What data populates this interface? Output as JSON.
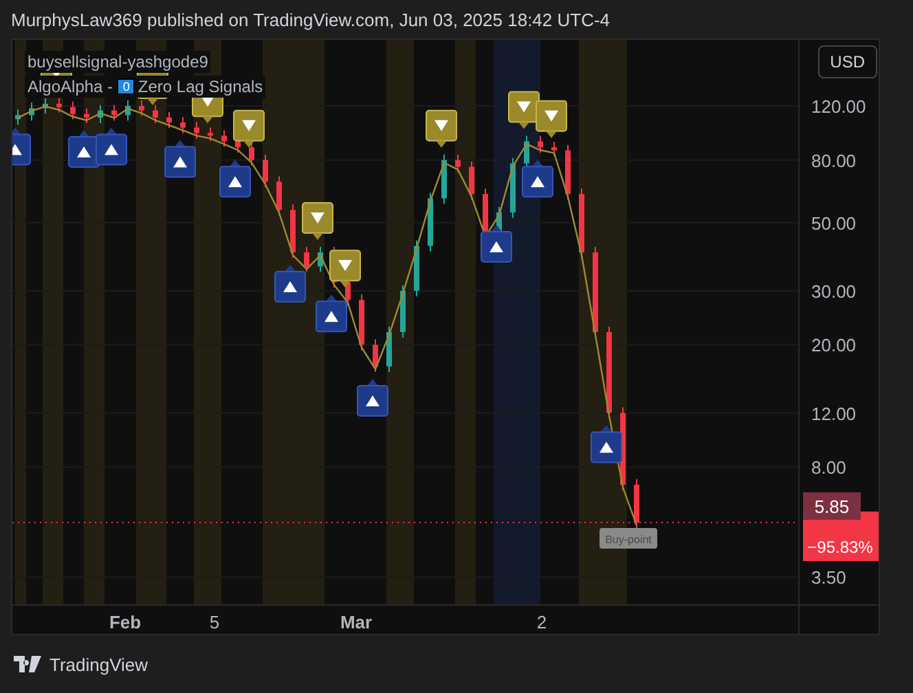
{
  "header": {
    "title": "MurphysLaw369 published on TradingView.com, Jun 03, 2025 18:42 UTC-4"
  },
  "legend": {
    "script": "buysellsignal-yashgode9",
    "indicator_prefix": "AlgoAlpha - ",
    "indicator_badge": "0",
    "indicator_name": "Zero Lag Signals"
  },
  "currency_button": "USD",
  "chart": {
    "price_axis": [
      "120.00",
      "80.00",
      "50.00",
      "30.00",
      "20.00",
      "12.00",
      "8.00",
      "3.50"
    ],
    "time_axis": [
      {
        "label": "Feb",
        "kind": "month"
      },
      {
        "label": "5",
        "kind": "day"
      },
      {
        "label": "Mar",
        "kind": "month"
      },
      {
        "label": "2",
        "kind": "day"
      }
    ],
    "signal_label": "Buy-point",
    "price_labels": {
      "marked_price": "5.85",
      "change": "−95.83%"
    }
  },
  "footer": {
    "brand": "TradingView"
  }
}
